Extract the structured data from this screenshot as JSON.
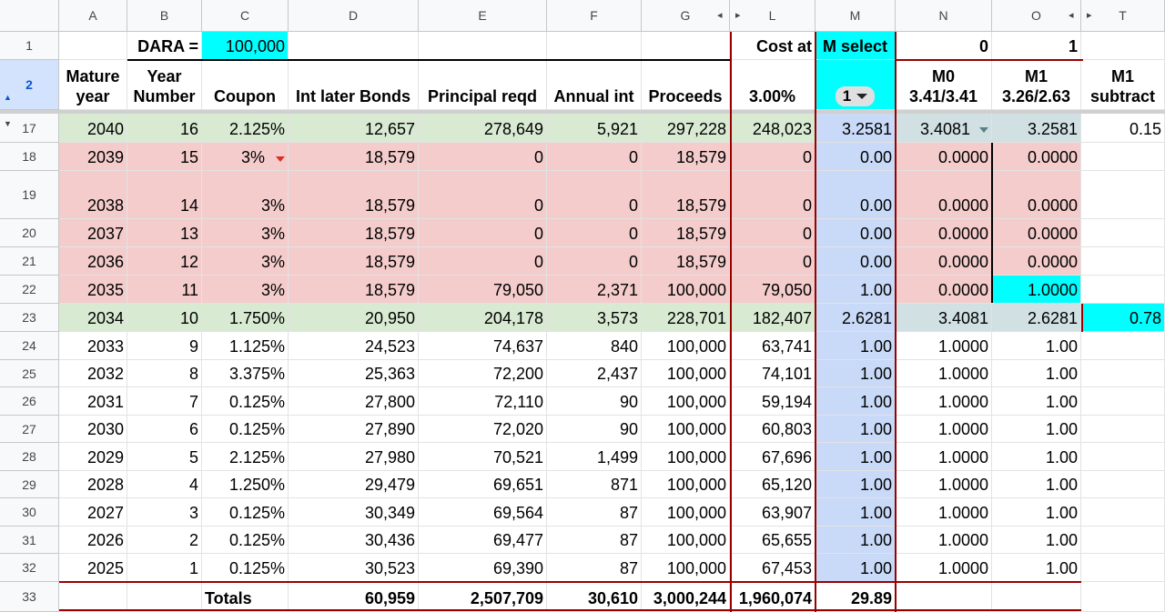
{
  "columns": [
    {
      "id": "A",
      "label": "A"
    },
    {
      "id": "B",
      "label": "B"
    },
    {
      "id": "C",
      "label": "C"
    },
    {
      "id": "D",
      "label": "D"
    },
    {
      "id": "E",
      "label": "E"
    },
    {
      "id": "F",
      "label": "F"
    },
    {
      "id": "G",
      "label": "G"
    },
    {
      "id": "L",
      "label": "L"
    },
    {
      "id": "M",
      "label": "M"
    },
    {
      "id": "N",
      "label": "N"
    },
    {
      "id": "O",
      "label": "O"
    },
    {
      "id": "T",
      "label": "T"
    }
  ],
  "column_group_arrows": {
    "left": "◂",
    "right": "▸"
  },
  "row1": {
    "dara_label": "DARA =",
    "dara_value": "100,000",
    "cost_at": "Cost at",
    "m_select": "M select",
    "n_value": "0",
    "o_value": "1"
  },
  "header": {
    "mature_year": [
      "Mature",
      "year"
    ],
    "year_number": [
      "Year",
      "Number"
    ],
    "coupon": "Coupon",
    "int_later_bonds": "Int later Bonds",
    "principal_reqd": "Principal reqd",
    "annual_int": "Annual int",
    "proceeds": "Proceeds",
    "cost_rate": "3.00%",
    "m_dropdown": "1",
    "m0": [
      "M0",
      "3.41/3.41"
    ],
    "m1": [
      "M1",
      "3.26/2.63"
    ],
    "m1_subtract": [
      "M1",
      "subtract"
    ]
  },
  "rows": [
    {
      "num": "17",
      "style": "green",
      "a": "2040",
      "b": "16",
      "c": "2.125%",
      "d": "12,657",
      "e": "278,649",
      "f": "5,921",
      "g": "297,228",
      "l": "248,023",
      "m": "3.2581",
      "n": "3.4081",
      "o": "3.2581",
      "t": "0.15"
    },
    {
      "num": "18",
      "style": "pink",
      "a": "2039",
      "b": "15",
      "c": "3%",
      "d": "18,579",
      "e": "0",
      "f": "0",
      "g": "18,579",
      "l": "0",
      "m": "0.00",
      "n": "0.0000",
      "o": "0.0000",
      "t": ""
    },
    {
      "num": "19",
      "style": "pink",
      "a": "2038",
      "b": "14",
      "c": "3%",
      "d": "18,579",
      "e": "0",
      "f": "0",
      "g": "18,579",
      "l": "0",
      "m": "0.00",
      "n": "0.0000",
      "o": "0.0000",
      "t": ""
    },
    {
      "num": "20",
      "style": "pink",
      "a": "2037",
      "b": "13",
      "c": "3%",
      "d": "18,579",
      "e": "0",
      "f": "0",
      "g": "18,579",
      "l": "0",
      "m": "0.00",
      "n": "0.0000",
      "o": "0.0000",
      "t": ""
    },
    {
      "num": "21",
      "style": "pink",
      "a": "2036",
      "b": "12",
      "c": "3%",
      "d": "18,579",
      "e": "0",
      "f": "0",
      "g": "18,579",
      "l": "0",
      "m": "0.00",
      "n": "0.0000",
      "o": "0.0000",
      "t": ""
    },
    {
      "num": "22",
      "style": "pink",
      "a": "2035",
      "b": "11",
      "c": "3%",
      "d": "18,579",
      "e": "79,050",
      "f": "2,371",
      "g": "100,000",
      "l": "79,050",
      "m": "1.00",
      "n": "0.0000",
      "o": "1.0000",
      "t": ""
    },
    {
      "num": "23",
      "style": "green",
      "a": "2034",
      "b": "10",
      "c": "1.750%",
      "d": "20,950",
      "e": "204,178",
      "f": "3,573",
      "g": "228,701",
      "l": "182,407",
      "m": "2.6281",
      "n": "3.4081",
      "o": "2.6281",
      "t": "0.78"
    },
    {
      "num": "24",
      "style": "",
      "a": "2033",
      "b": "9",
      "c": "1.125%",
      "d": "24,523",
      "e": "74,637",
      "f": "840",
      "g": "100,000",
      "l": "63,741",
      "m": "1.00",
      "n": "1.0000",
      "o": "1.00",
      "t": ""
    },
    {
      "num": "25",
      "style": "",
      "a": "2032",
      "b": "8",
      "c": "3.375%",
      "d": "25,363",
      "e": "72,200",
      "f": "2,437",
      "g": "100,000",
      "l": "74,101",
      "m": "1.00",
      "n": "1.0000",
      "o": "1.00",
      "t": ""
    },
    {
      "num": "26",
      "style": "",
      "a": "2031",
      "b": "7",
      "c": "0.125%",
      "d": "27,800",
      "e": "72,110",
      "f": "90",
      "g": "100,000",
      "l": "59,194",
      "m": "1.00",
      "n": "1.0000",
      "o": "1.00",
      "t": ""
    },
    {
      "num": "27",
      "style": "",
      "a": "2030",
      "b": "6",
      "c": "0.125%",
      "d": "27,890",
      "e": "72,020",
      "f": "90",
      "g": "100,000",
      "l": "60,803",
      "m": "1.00",
      "n": "1.0000",
      "o": "1.00",
      "t": ""
    },
    {
      "num": "28",
      "style": "",
      "a": "2029",
      "b": "5",
      "c": "2.125%",
      "d": "27,980",
      "e": "70,521",
      "f": "1,499",
      "g": "100,000",
      "l": "67,696",
      "m": "1.00",
      "n": "1.0000",
      "o": "1.00",
      "t": ""
    },
    {
      "num": "29",
      "style": "",
      "a": "2028",
      "b": "4",
      "c": "1.250%",
      "d": "29,479",
      "e": "69,651",
      "f": "871",
      "g": "100,000",
      "l": "65,120",
      "m": "1.00",
      "n": "1.0000",
      "o": "1.00",
      "t": ""
    },
    {
      "num": "30",
      "style": "",
      "a": "2027",
      "b": "3",
      "c": "0.125%",
      "d": "30,349",
      "e": "69,564",
      "f": "87",
      "g": "100,000",
      "l": "63,907",
      "m": "1.00",
      "n": "1.0000",
      "o": "1.00",
      "t": ""
    },
    {
      "num": "31",
      "style": "",
      "a": "2026",
      "b": "2",
      "c": "0.125%",
      "d": "30,436",
      "e": "69,477",
      "f": "87",
      "g": "100,000",
      "l": "65,655",
      "m": "1.00",
      "n": "1.0000",
      "o": "1.00",
      "t": ""
    },
    {
      "num": "32",
      "style": "",
      "a": "2025",
      "b": "1",
      "c": "0.125%",
      "d": "30,523",
      "e": "69,390",
      "f": "87",
      "g": "100,000",
      "l": "67,453",
      "m": "1.00",
      "n": "1.0000",
      "o": "1.00",
      "t": ""
    }
  ],
  "totals": {
    "num": "33",
    "label": "Totals",
    "d": "60,959",
    "e": "2,507,709",
    "f": "30,610",
    "g": "3,000,244",
    "l": "1,960,074",
    "m": "29.89"
  },
  "colors": {
    "green": "#d9ead3",
    "pink": "#f4cccc",
    "blue": "#c9daf8",
    "cyan": "#00ffff",
    "gray": "#d0e0e3",
    "border_red": "#990000",
    "header_bg": "#f8f9fa",
    "selected_row": "#d3e3fd"
  },
  "icons": {
    "dropdown": "triangle-down-icon",
    "note": "red-triangle-icon",
    "group_toggle": "row-group-toggle-icon"
  }
}
